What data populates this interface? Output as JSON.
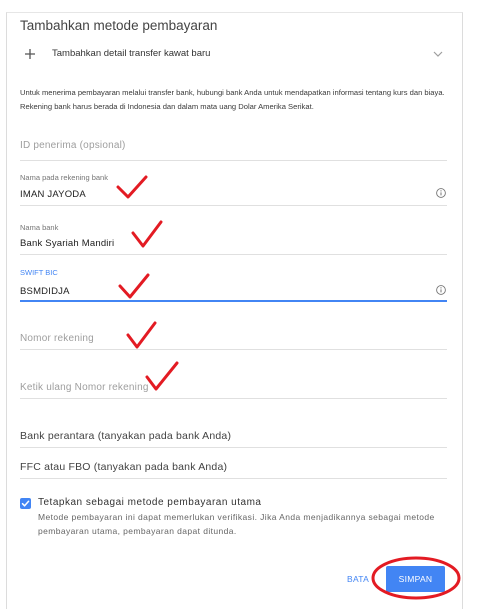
{
  "header": {
    "title": "Tambahkan metode pembayaran"
  },
  "add_transfer": {
    "label": "Tambahkan detail transfer kawat baru"
  },
  "info_text": "Untuk menerima pembayaran melalui transfer bank, hubungi bank Anda untuk mendapatkan informasi tentang kurs dan biaya. Rekening bank harus berada di Indonesia dan dalam mata uang Dolar Amerika Serikat.",
  "fields": {
    "recipient_id": {
      "placeholder": "ID penerima (opsional)"
    },
    "account_name": {
      "label": "Nama pada rekening bank",
      "value": "IMAN JAYODA"
    },
    "bank_name": {
      "label": "Nama bank",
      "value": "Bank Syariah Mandiri"
    },
    "swift_bic": {
      "label": "SWIFT BIC",
      "value": "BSMDIDJA",
      "focused": true
    },
    "account_number": {
      "placeholder": "Nomor rekening"
    },
    "account_number_confirm": {
      "placeholder": "Ketik ulang Nomor rekening"
    },
    "intermediary_bank": {
      "placeholder": "Bank perantara (tanyakan pada bank Anda)"
    },
    "ffc_fbo": {
      "placeholder": "FFC atau FBO (tanyakan pada bank Anda)"
    }
  },
  "primary_method": {
    "checked": true,
    "label": "Tetapkan sebagai metode pembayaran utama",
    "note": "Metode pembayaran ini dapat memerlukan verifikasi. Jika Anda menjadikannya sebagai metode pembayaran utama, pembayaran dapat ditunda."
  },
  "actions": {
    "cancel_label": "BATA",
    "save_label": "SIMPAN"
  },
  "icons": {
    "add": "plus-icon",
    "expand": "chevron-down-icon",
    "field_info": "info-icon",
    "checkbox_check": "checkmark-icon"
  },
  "colors": {
    "accent": "#4285f4",
    "annotation": "#e31b23"
  }
}
